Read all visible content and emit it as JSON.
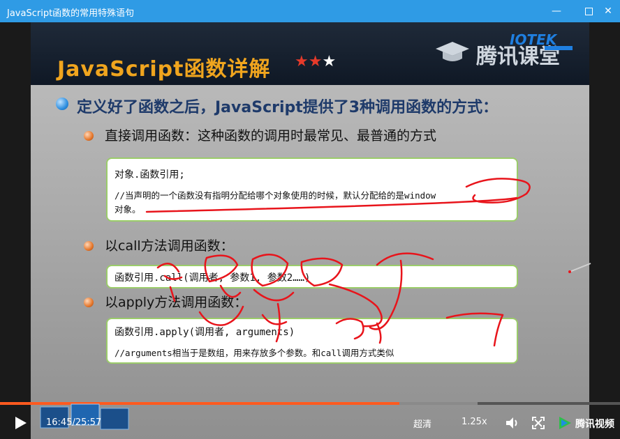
{
  "window": {
    "title": "JavaScript函数的常用特殊语句"
  },
  "slide": {
    "title": "JavaScript函数详解",
    "stars": {
      "filled": 2,
      "total": 3
    },
    "logo_text": "腾讯课堂",
    "main_point": "定义好了函数之后，JavaScript提供了3种调用函数的方式：",
    "methods": [
      {
        "label": "直接调用函数：这种函数的调用时最常见、最普通的方式",
        "code": [
          "对象.函数引用;",
          "//当声明的一个函数没有指明分配给哪个对象使用的时候，默认分配给的是window",
          "对象。"
        ]
      },
      {
        "label": "以call方法调用函数：",
        "code": [
          "函数引用.call(调用者, 参数1, 参数2……)"
        ]
      },
      {
        "label": "以apply方法调用函数：",
        "code": [
          "函数引用.apply(调用者, arguments)",
          "//arguments相当于是数组，用来存放多个参数。和call调用方式类似"
        ]
      }
    ]
  },
  "player": {
    "time_current": "16:45",
    "time_total": "25:57",
    "progress_fraction": 0.644,
    "buffered_fraction": 0.77,
    "quality_label": "超清",
    "speed_label": "1.25x",
    "brand_label": "腾讯视频"
  },
  "colors": {
    "accent": "#ff5a1f",
    "titlebar": "#2f9be5",
    "slide_title": "#f0a51e",
    "ink": "#e8141b"
  }
}
